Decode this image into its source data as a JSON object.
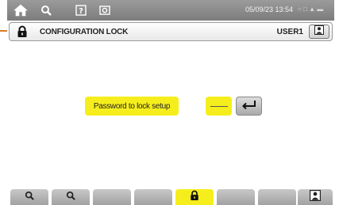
{
  "statusbar": {
    "home_icon": "home-icon",
    "config_icon": "wrench-icon",
    "help_icon": "help-icon",
    "screenshot_icon": "camera-icon",
    "datetime": "05/09/23 13:54",
    "indicators": "○  □ ▲ ▬"
  },
  "titlebar": {
    "lock_icon": "lock-icon",
    "title": "CONFIGURATION LOCK",
    "user": "USER1",
    "user_icon": "user-icon"
  },
  "main": {
    "password_label": "Password to lock setup",
    "password_value": "",
    "enter_icon": "enter-icon"
  },
  "function_keys": [
    {
      "icon": "wrench-icon",
      "active": false
    },
    {
      "icon": "wrench-icon",
      "active": false
    },
    {
      "icon": "",
      "active": false
    },
    {
      "icon": "",
      "active": false
    },
    {
      "icon": "lock-icon",
      "active": true
    },
    {
      "icon": "",
      "active": false
    },
    {
      "icon": "",
      "active": false
    },
    {
      "icon": "user-icon",
      "active": false
    }
  ],
  "colors": {
    "highlight": "#f6ee1c",
    "statusbar": "#8a8a8a",
    "callout": "#d97a2a"
  }
}
